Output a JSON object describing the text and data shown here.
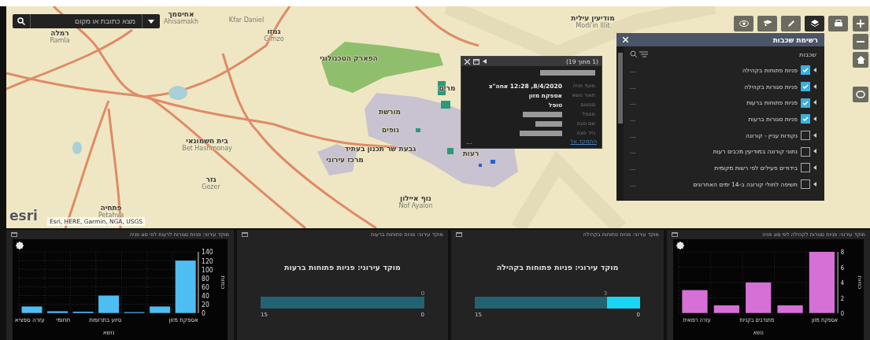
{
  "map": {
    "search": {
      "placeholder": "מצא כתובת או מקום"
    },
    "places": [
      {
        "name": "מודיעין עילית",
        "latin": "Modi'in Illit"
      },
      {
        "latin": "Kfar Daniel"
      },
      {
        "name": "אחיסמך",
        "latin": "Ahisamakh"
      },
      {
        "name": "גמזו",
        "latin": "Gimzo"
      },
      {
        "name": "רמלה",
        "latin": "Ramla"
      },
      {
        "name": "הפארק הטכנולוגי"
      },
      {
        "name": "מרים"
      },
      {
        "name": "מורשת"
      },
      {
        "name": "נופים"
      },
      {
        "name": "בית חשמונאי",
        "latin": "Bet Hashmonay"
      },
      {
        "name": "רעות"
      },
      {
        "name": "גבעת שר תכנון בעתיד"
      },
      {
        "name": "מרכז עירוני"
      },
      {
        "name": "גזר",
        "latin": "Gezer"
      },
      {
        "name": "נוף איילון",
        "latin": "Nof Ayalon"
      },
      {
        "name": "פתחיה",
        "latin": "Petahya"
      }
    ],
    "logo": "esri",
    "attribution": "Esri, HERE, Garmin, NGA, USGS",
    "toolbar": [
      {
        "kind": "eye",
        "selected": false
      },
      {
        "kind": "hat",
        "selected": false
      },
      {
        "kind": "pencil",
        "selected": false
      },
      {
        "kind": "layers",
        "selected": true
      },
      {
        "kind": "print",
        "selected": false
      }
    ]
  },
  "popup": {
    "counter": "(1 מתוך 19)",
    "rows": [
      {
        "label": "מועד פניה",
        "value": "8/4/2020, 12:28 אחה\"צ",
        "kind": "text"
      },
      {
        "label": "תאור נושא",
        "value": "אספקת מזון",
        "kind": "text"
      },
      {
        "label": "סטטוס",
        "value": "טופל",
        "kind": "text"
      },
      {
        "label": "מטפל",
        "kind": "redacted"
      },
      {
        "label": "שם פונה",
        "kind": "redacted"
      },
      {
        "label": "נייד פונה",
        "kind": "redacted"
      }
    ],
    "zoom_link": "התמקד אל",
    "more": "..."
  },
  "layer_list": {
    "title": "רשימת שכבות",
    "section": "שכבות",
    "items": [
      {
        "label": "פניות פתוחות בקהילה",
        "checked": true
      },
      {
        "label": "פניות סגורות בקהילה",
        "checked": true
      },
      {
        "label": "פניות פתוחות ברעות",
        "checked": true
      },
      {
        "label": "פניות סגורות ברעות",
        "checked": true
      },
      {
        "label": "נקודות עניין - קורונה",
        "checked": false
      },
      {
        "label": "נתוני קורונה במודיעין מכבים רעות",
        "checked": false
      },
      {
        "label": "בידודים פעילים לפי רשות מקומית",
        "checked": false
      },
      {
        "label": "חשיפה לחולי קורונה ב-14 ימים האחרונים",
        "checked": false
      }
    ],
    "more": "..."
  },
  "panels": [
    {
      "kind": "chart",
      "title": "מוקד עירוני: פניות סגורות לקהילה לפי סוג פניה",
      "chart_data": {
        "type": "bar",
        "xlabel": "נושא",
        "ylabel": "כמות",
        "grid": true,
        "categories": [
          "עזרה רפואית",
          null,
          "מתנדבים בקניות",
          null,
          "אספקת מזון"
        ],
        "series": [
          {
            "color": "#d670d6",
            "values": [
              3,
              1,
              4,
              1,
              8
            ]
          }
        ],
        "ylim": [
          0,
          8
        ],
        "yticks": [
          0,
          2,
          4,
          6,
          8
        ]
      }
    },
    {
      "kind": "gauge",
      "title": "מוקד עירוני: פניות פתוחות בקהילה",
      "heading": "מוקד עירוני: פניות פתוחות בקהילה",
      "value": "3",
      "min": "0",
      "max": "15",
      "level": 0.2
    },
    {
      "kind": "gauge",
      "title": "מוקד עירוני: פניות פתוחות ברעות",
      "heading": "מוקד עירוני: פניות פתוחות ברעות",
      "value": "0",
      "min": "0",
      "max": "15",
      "level": 0
    },
    {
      "kind": "chart",
      "title": "מוקד עירוני: פניות סגורות לרעות לפי סוג פניה",
      "chart_data": {
        "type": "bar",
        "xlabel": "נושא",
        "ylabel": "כמות",
        "grid": true,
        "categories": [
          "עזרה ספציא",
          "תחומי",
          null,
          "סיוע בתרופות",
          null,
          null,
          "אספקת מזון"
        ],
        "series": [
          {
            "color": "#4dbdf2",
            "values": [
              15,
              4,
              3,
              40,
              2,
              15,
              120
            ]
          }
        ],
        "ylim": [
          0,
          140
        ],
        "yticks": [
          0,
          20,
          40,
          60,
          80,
          100,
          120,
          140
        ]
      }
    }
  ]
}
